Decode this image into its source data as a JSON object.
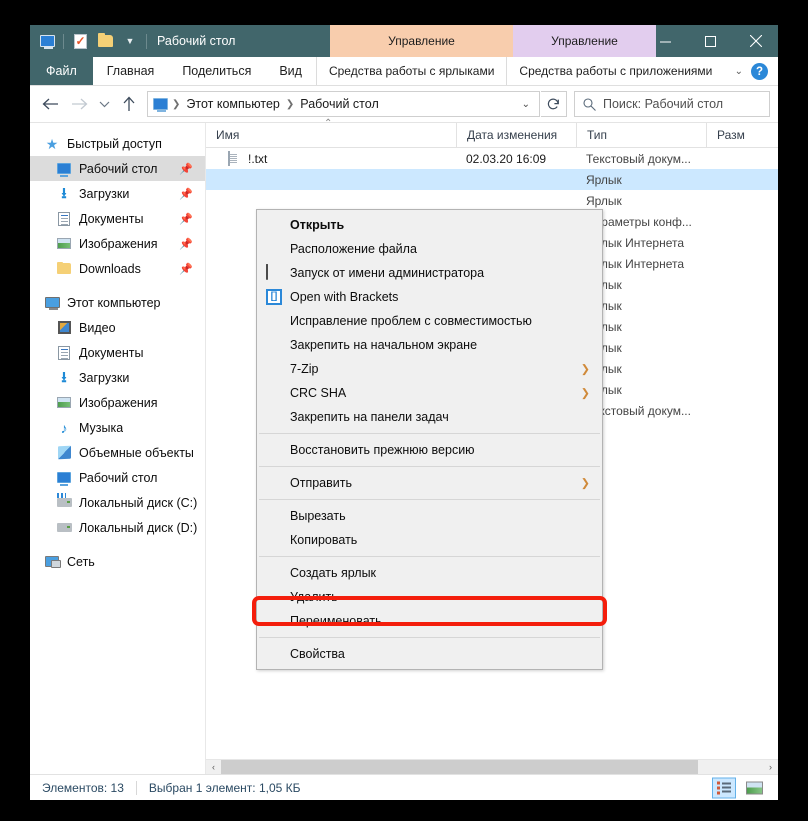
{
  "window": {
    "title": "Рабочий стол",
    "quick_access": [
      {
        "name": "desktop-icon",
        "label": "Рабочий стол"
      },
      {
        "name": "properties-icon",
        "label": "Свойства"
      },
      {
        "name": "new-folder-icon",
        "label": "Создать папку"
      },
      {
        "name": "customize-caret",
        "label": "Настроить панель быстрого доступа"
      }
    ],
    "contextual_tabs": [
      {
        "label": "Управление",
        "sub": "Средства работы с ярлыками",
        "color": "#f8cdad"
      },
      {
        "label": "Управление",
        "sub": "Средства работы с приложениями",
        "color": "#e2cdee"
      }
    ],
    "controls": {
      "minimize": "Свернуть",
      "maximize": "Развернуть",
      "close": "Закрыть"
    }
  },
  "ribbon": {
    "file_tab": "Файл",
    "tabs": [
      "Главная",
      "Поделиться",
      "Вид"
    ],
    "help_label": "?",
    "expand_label": "Свернуть ленту"
  },
  "address": {
    "back": "Назад",
    "forward": "Вперёд",
    "recent": "Последние расположения",
    "up": "Вверх",
    "breadcrumbs": [
      "Этот компьютер",
      "Рабочий стол"
    ],
    "refresh": "Обновить",
    "dropdown": "Предыдущие расположения"
  },
  "search": {
    "placeholder": "Поиск: Рабочий стол"
  },
  "sidebar": {
    "groups": [
      {
        "header": {
          "label": "Быстрый доступ",
          "icon": "star-pin-icon"
        },
        "items": [
          {
            "label": "Рабочий стол",
            "icon": "desktop-icon",
            "pinned": true,
            "selected": true
          },
          {
            "label": "Загрузки",
            "icon": "downloads-icon",
            "pinned": true,
            "selected": false
          },
          {
            "label": "Документы",
            "icon": "documents-icon",
            "pinned": true,
            "selected": false
          },
          {
            "label": "Изображения",
            "icon": "pictures-icon",
            "pinned": true,
            "selected": false
          },
          {
            "label": "Downloads",
            "icon": "folder-icon",
            "pinned": true,
            "selected": false
          }
        ]
      },
      {
        "header": {
          "label": "Этот компьютер",
          "icon": "this-pc-icon"
        },
        "items": [
          {
            "label": "Видео",
            "icon": "videos-icon",
            "pinned": false,
            "selected": false
          },
          {
            "label": "Документы",
            "icon": "documents-icon",
            "pinned": false,
            "selected": false
          },
          {
            "label": "Загрузки",
            "icon": "downloads-icon",
            "pinned": false,
            "selected": false
          },
          {
            "label": "Изображения",
            "icon": "pictures-icon",
            "pinned": false,
            "selected": false
          },
          {
            "label": "Музыка",
            "icon": "music-icon",
            "pinned": false,
            "selected": false
          },
          {
            "label": "Объемные объекты",
            "icon": "3d-objects-icon",
            "pinned": false,
            "selected": false
          },
          {
            "label": "Рабочий стол",
            "icon": "desktop-icon",
            "pinned": false,
            "selected": false
          },
          {
            "label": "Локальный диск (C:)",
            "icon": "system-drive-icon",
            "pinned": false,
            "selected": false
          },
          {
            "label": "Локальный диск (D:)",
            "icon": "drive-icon",
            "pinned": false,
            "selected": false
          }
        ]
      },
      {
        "header": {
          "label": "Сеть",
          "icon": "network-icon"
        },
        "items": []
      }
    ]
  },
  "filelist": {
    "columns": [
      {
        "key": "name",
        "label": "Имя",
        "sorted": true
      },
      {
        "key": "date",
        "label": "Дата изменения",
        "sorted": false
      },
      {
        "key": "type",
        "label": "Тип",
        "sorted": false
      },
      {
        "key": "size",
        "label": "Разм",
        "sorted": false
      }
    ],
    "rows": [
      {
        "name": "!.txt",
        "date": "02.03.20 16:09",
        "type": "Текстовый докум...",
        "size": "",
        "icon": "text-file-icon",
        "selected": false
      },
      {
        "name": "",
        "date": "",
        "type": "Ярлык",
        "size": "",
        "icon": "shortcut-icon",
        "selected": true
      },
      {
        "name": "",
        "date": "",
        "type": "Ярлык",
        "size": "",
        "icon": "shortcut-icon",
        "selected": false
      },
      {
        "name": "",
        "date": "",
        "type": "Параметры конф...",
        "size": "",
        "icon": "config-icon",
        "selected": false
      },
      {
        "name": "",
        "date": "",
        "type": "Ярлык Интернета",
        "size": "",
        "icon": "internet-shortcut-icon",
        "selected": false
      },
      {
        "name": "",
        "date": "",
        "type": "Ярлык Интернета",
        "size": "",
        "icon": "internet-shortcut-icon",
        "selected": false
      },
      {
        "name": "",
        "date": "",
        "type": "Ярлык",
        "size": "",
        "icon": "shortcut-icon",
        "selected": false
      },
      {
        "name": "",
        "date": "",
        "type": "Ярлык",
        "size": "",
        "icon": "shortcut-icon",
        "selected": false
      },
      {
        "name": "",
        "date": "",
        "type": "Ярлык",
        "size": "",
        "icon": "shortcut-icon",
        "selected": false
      },
      {
        "name": "",
        "date": "",
        "type": "Ярлык",
        "size": "",
        "icon": "shortcut-icon",
        "selected": false
      },
      {
        "name": "",
        "date": "",
        "type": "Ярлык",
        "size": "",
        "icon": "shortcut-icon",
        "selected": false
      },
      {
        "name": "",
        "date": "",
        "type": "Ярлык",
        "size": "",
        "icon": "shortcut-icon",
        "selected": false
      },
      {
        "name": "",
        "date": "",
        "type": "Текстовый докум...",
        "size": "",
        "icon": "text-file-icon",
        "selected": false
      }
    ]
  },
  "context_menu": {
    "items": [
      {
        "label": "Открыть",
        "bold": true,
        "icon": null,
        "submenu": false
      },
      {
        "label": "Расположение файла",
        "bold": false,
        "icon": null,
        "submenu": false
      },
      {
        "label": "Запуск от имени администратора",
        "bold": false,
        "icon": "shield-icon",
        "submenu": false
      },
      {
        "label": "Open with Brackets",
        "bold": false,
        "icon": "brackets-icon",
        "submenu": false
      },
      {
        "label": "Исправление проблем с совместимостью",
        "bold": false,
        "icon": null,
        "submenu": false
      },
      {
        "label": "Закрепить на начальном экране",
        "bold": false,
        "icon": null,
        "submenu": false
      },
      {
        "label": "7-Zip",
        "bold": false,
        "icon": null,
        "submenu": true
      },
      {
        "label": "CRC SHA",
        "bold": false,
        "icon": null,
        "submenu": true
      },
      {
        "label": "Закрепить на панели задач",
        "bold": false,
        "icon": null,
        "submenu": false
      },
      {
        "separator": true
      },
      {
        "label": "Восстановить прежнюю версию",
        "bold": false,
        "icon": null,
        "submenu": false
      },
      {
        "separator": true
      },
      {
        "label": "Отправить",
        "bold": false,
        "icon": null,
        "submenu": true
      },
      {
        "separator": true
      },
      {
        "label": "Вырезать",
        "bold": false,
        "icon": null,
        "submenu": false
      },
      {
        "label": "Копировать",
        "bold": false,
        "icon": null,
        "submenu": false
      },
      {
        "separator": true
      },
      {
        "label": "Создать ярлык",
        "bold": false,
        "icon": null,
        "submenu": false
      },
      {
        "label": "Удалить",
        "bold": false,
        "icon": null,
        "submenu": false
      },
      {
        "label": "Переименовать",
        "bold": false,
        "icon": null,
        "submenu": false
      },
      {
        "separator": true
      },
      {
        "label": "Свойства",
        "bold": false,
        "icon": null,
        "submenu": false,
        "highlighted": true
      }
    ]
  },
  "annotation": {
    "highlight_color": "#f41e0c",
    "target": "Свойства"
  },
  "statusbar": {
    "item_count": "Элементов: 13",
    "selection": "Выбран 1 элемент: 1,05 КБ",
    "views": [
      {
        "name": "details-view-button",
        "label": "Крупные значки",
        "active": true
      },
      {
        "name": "large-icons-view-button",
        "label": "Таблица",
        "active": false
      }
    ]
  },
  "scrollbars": {
    "horizontal_left": "‹",
    "horizontal_right": "›"
  }
}
